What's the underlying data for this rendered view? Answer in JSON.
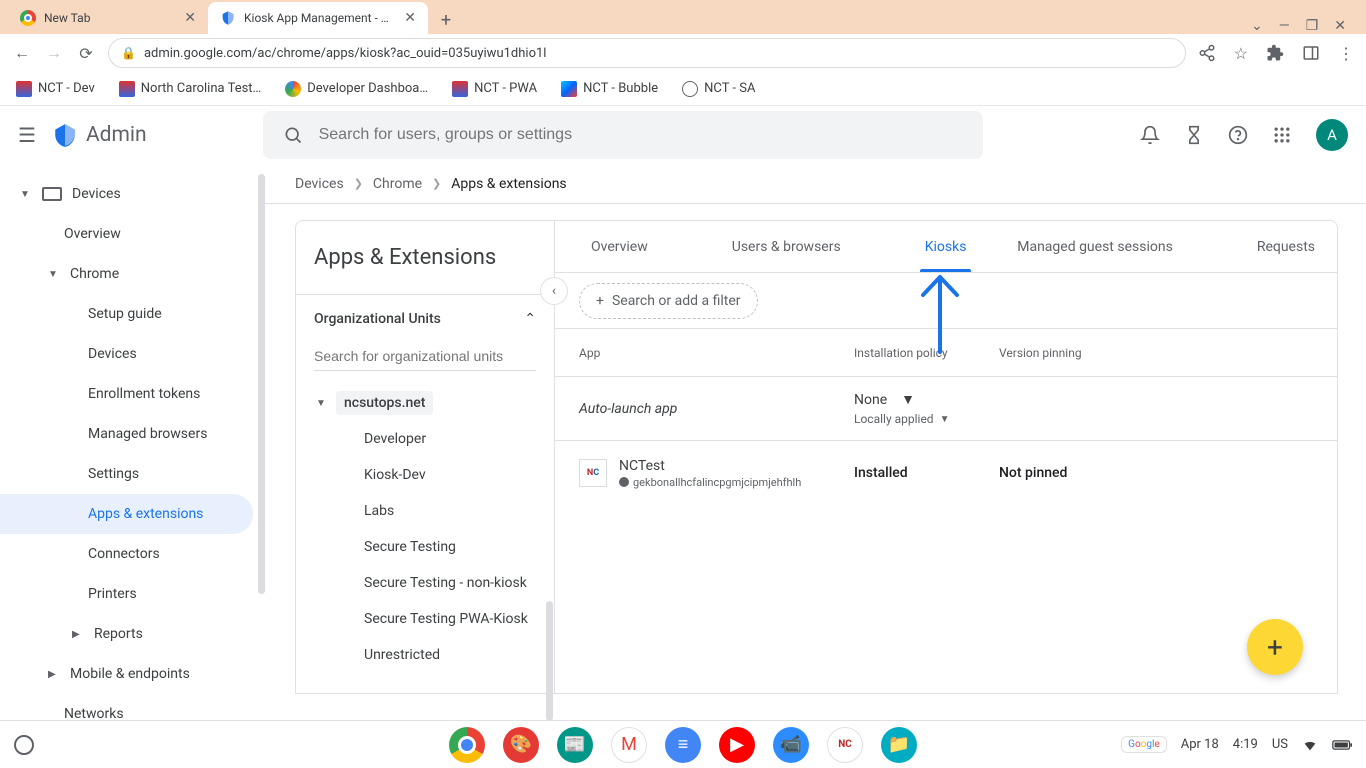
{
  "browser": {
    "tabs": [
      {
        "title": "New Tab",
        "favicon": "chrome"
      },
      {
        "title": "Kiosk App Management - Admin",
        "favicon": "admin"
      }
    ],
    "window_controls": {
      "dropdown": "⌄",
      "min": "—",
      "max": "❐",
      "close": "✕"
    },
    "url": "admin.google.com/ac/chrome/apps/kiosk?ac_ouid=035uyiwu1dhio1l"
  },
  "bookmarks": [
    {
      "label": "NCT - Dev"
    },
    {
      "label": "North Carolina Test…"
    },
    {
      "label": "Developer Dashboa…"
    },
    {
      "label": "NCT - PWA"
    },
    {
      "label": "NCT - Bubble"
    },
    {
      "label": "NCT - SA"
    }
  ],
  "header": {
    "brand": "Admin",
    "search_placeholder": "Search for users, groups or settings",
    "avatar_letter": "A"
  },
  "leftnav": {
    "devices": "Devices",
    "overview": "Overview",
    "chrome": "Chrome",
    "setup": "Setup guide",
    "devices2": "Devices",
    "enroll": "Enrollment tokens",
    "managed": "Managed browsers",
    "settings": "Settings",
    "apps": "Apps & extensions",
    "connectors": "Connectors",
    "printers": "Printers",
    "reports": "Reports",
    "mobile": "Mobile & endpoints",
    "networks": "Networks"
  },
  "breadcrumb": {
    "a": "Devices",
    "b": "Chrome",
    "c": "Apps & extensions"
  },
  "ou": {
    "title": "Apps & Extensions",
    "section": "Organizational Units",
    "search_placeholder": "Search for organizational units",
    "root": "ncsutops.net",
    "children": [
      "Developer",
      "Kiosk-Dev",
      "Labs",
      "Secure Testing",
      "Secure Testing - non-kiosk",
      "Secure Testing PWA-Kiosk",
      "Unrestricted"
    ]
  },
  "tabs": {
    "overview": "Overview",
    "users": "Users & browsers",
    "kiosks": "Kiosks",
    "mgs": "Managed guest sessions",
    "requests": "Requests"
  },
  "filter": {
    "chip": "Search or add a filter"
  },
  "columns": {
    "app": "App",
    "install": "Installation policy",
    "version": "Version pinning"
  },
  "auto_launch": {
    "label": "Auto-launch app",
    "value": "None",
    "sub": "Locally applied"
  },
  "app_row": {
    "name": "NCTest",
    "id": "gekbonallhcfalincpgmjcipmjehfhlh",
    "install": "Installed",
    "version": "Not pinned"
  },
  "shelf": {
    "date": "Apr 18",
    "time": "4:19",
    "lang": "US"
  }
}
